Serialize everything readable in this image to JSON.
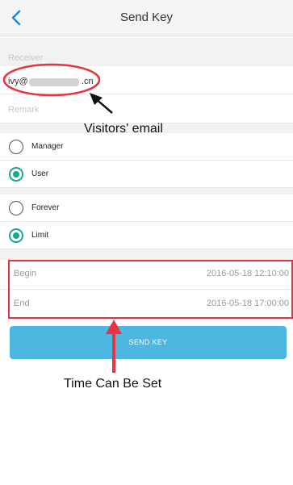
{
  "header": {
    "title": "Send Key"
  },
  "receiver": {
    "label": "Receiver",
    "email_start": "ivy@",
    "email_end": ".cn"
  },
  "remark": {
    "placeholder": "Remark"
  },
  "role_options": [
    {
      "label": "Manager",
      "checked": false
    },
    {
      "label": "User",
      "checked": true
    }
  ],
  "duration_options": [
    {
      "label": "Forever",
      "checked": false
    },
    {
      "label": "Limit",
      "checked": true
    }
  ],
  "time": {
    "begin_label": "Begin",
    "begin_value": "2016-05-18 12:10:00",
    "end_label": "End",
    "end_value": "2016-05-18 17:00:00"
  },
  "send_button": {
    "label": "SEND KEY"
  },
  "annotations": {
    "email_note": "Visitors' email",
    "time_note": "Time Can Be Set"
  },
  "colors": {
    "accent": "#1ba59a",
    "button": "#4db6e1",
    "annotation": "#e8343f"
  },
  "icons": {
    "back": "chevron-left-icon"
  }
}
